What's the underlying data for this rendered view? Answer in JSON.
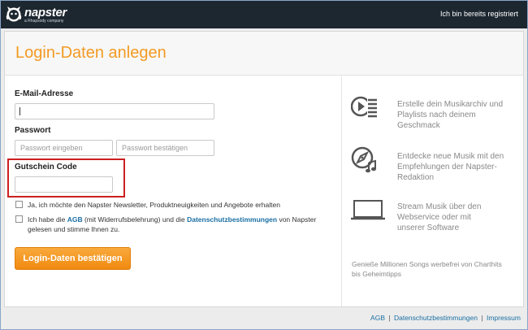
{
  "header": {
    "logo_word": "napster",
    "logo_sub": "a Rhapsody company",
    "already_registered": "Ich bin bereits registriert"
  },
  "form": {
    "title": "Login-Daten anlegen",
    "email_label": "E-Mail-Adresse",
    "email_value": "",
    "password_label": "Passwort",
    "password_placeholder": "Passwort eingeben",
    "password_confirm_placeholder": "Passwort bestätigen",
    "voucher_label": "Gutschein Code",
    "voucher_value": "",
    "newsletter_text": "Ja, ich möchte den Napster Newsletter, Produktneuigkeiten und Angebote erhalten",
    "terms_prefix": "Ich habe die ",
    "terms_agb": "AGB",
    "terms_middle": " (mit Widerrufsbelehrung) und die ",
    "terms_privacy": "Datenschutzbestimmungen",
    "terms_suffix": " von Napster",
    "terms_line2": "gelesen und stimme Ihnen zu.",
    "submit_label": "Login-Daten bestätigen"
  },
  "features": [
    {
      "icon": "playlist-icon",
      "line1": "Erstelle dein Musikarchiv und",
      "line2": "Playlists nach deinem",
      "line3": "Geschmack"
    },
    {
      "icon": "compass-music-icon",
      "line1": "Entdecke neue Musik mit den",
      "line2": "Empfehlungen der Napster-",
      "line3": "Redaktion"
    },
    {
      "icon": "laptop-icon",
      "line1": "Stream Musik über den",
      "line2": "Webservice oder mit",
      "line3": "unserer Software"
    }
  ],
  "tagline_line1": "Genieße Millionen Songs werbefrei von Charthits",
  "tagline_line2": "bis Geheimtipps",
  "footer": {
    "agb": "AGB",
    "privacy": "Datenschutzbestimmungen",
    "imprint": "Impressum",
    "separator": "|"
  },
  "colors": {
    "accent": "#f39a23",
    "link": "#1a6fa3",
    "topbar": "#1d2730",
    "highlight": "#cc1f1f"
  }
}
